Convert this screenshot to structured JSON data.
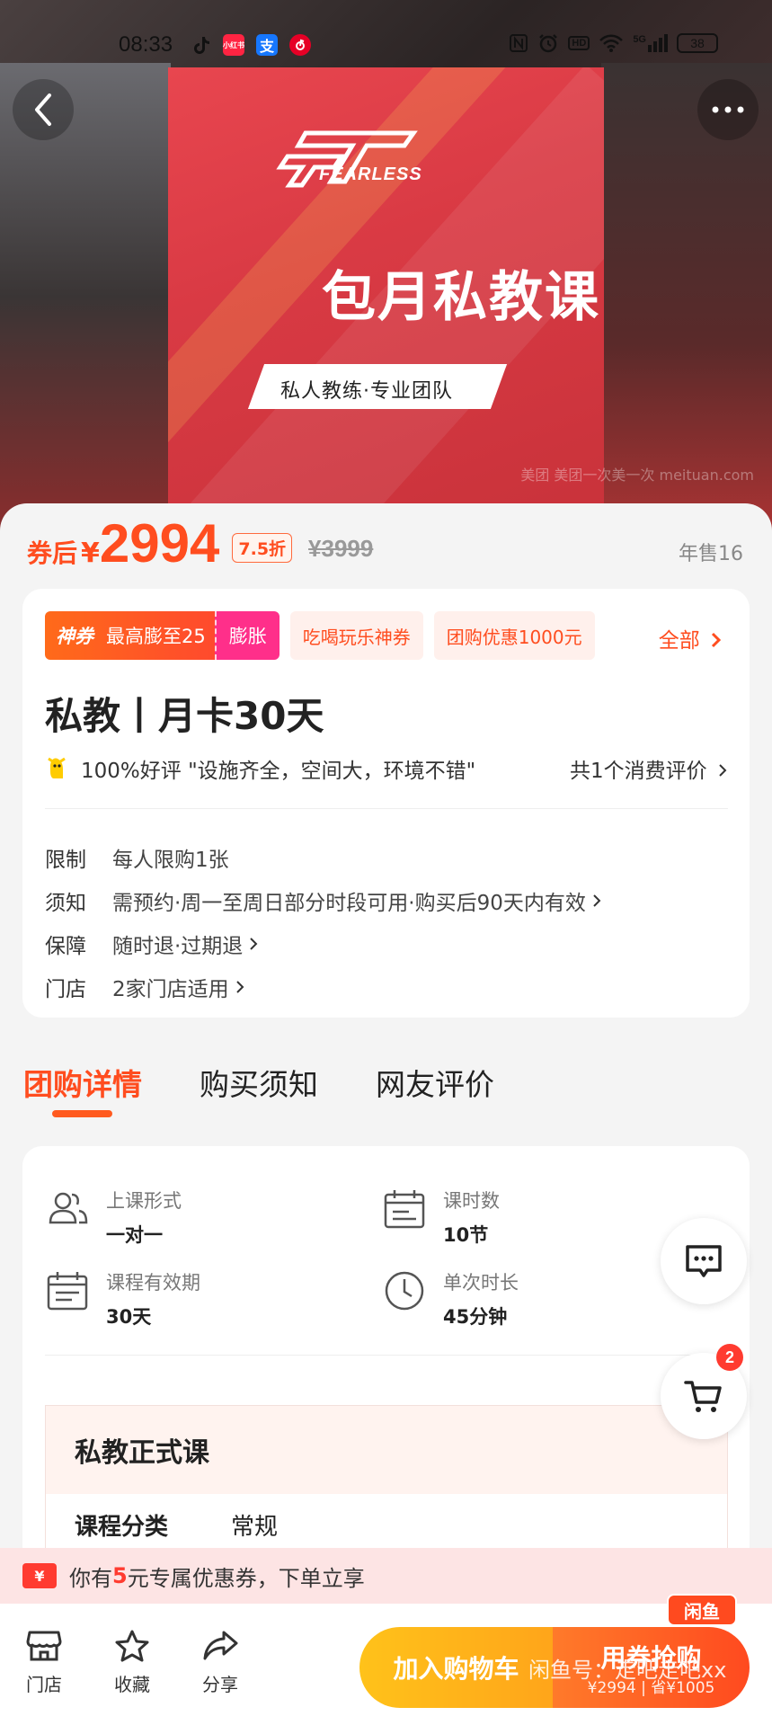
{
  "status_bar": {
    "time": "08:33",
    "apps": [
      "tiktok-icon",
      "xiaohongshu-icon",
      "alipay-icon",
      "netease-music-icon"
    ],
    "xiaohongshu_label": "小红书",
    "alipay_label": "支",
    "right_icons": [
      "nfc-icon",
      "alarm-icon",
      "hd-icon",
      "wifi-icon",
      "5g-signal-icon"
    ],
    "hd_label": "HD",
    "signal_label": "5G",
    "battery": "38"
  },
  "hero": {
    "logo_text": "FEARLESS",
    "title": "包月私教课",
    "subtitle": "私人教练·专业团队",
    "watermark": "美团 美团一次美一次 meituan.com"
  },
  "price": {
    "prefix": "券后",
    "currency": "¥",
    "value": "2994",
    "discount": "7.5折",
    "original": "¥3999",
    "sold": "年售16"
  },
  "coupons": {
    "main_tag": "神券",
    "main_text": "最高膨至25",
    "main_action": "膨胀",
    "chip1": "吃喝玩乐神券",
    "chip2": "团购优惠1000元",
    "all": "全部"
  },
  "product": {
    "title": "私教丨月卡30天",
    "review_text": "100%好评 \"设施齐全，空间大，环境不错\"",
    "review_count": "共1个消费评价"
  },
  "details": [
    {
      "key": "限制",
      "value": "每人限购1张",
      "arrow": false
    },
    {
      "key": "须知",
      "value": "需预约·周一至周日部分时段可用·购买后90天内有效",
      "arrow": true
    },
    {
      "key": "保障",
      "value": "随时退·过期退",
      "arrow": true
    },
    {
      "key": "门店",
      "value": "2家门店适用",
      "arrow": true
    }
  ],
  "tabs": [
    "团购详情",
    "购买须知",
    "网友评价"
  ],
  "attributes": [
    {
      "icon": "people-icon",
      "label": "上课形式",
      "value": "一对一"
    },
    {
      "icon": "schedule-icon",
      "label": "课时数",
      "value": "10节"
    },
    {
      "icon": "calendar-list-icon",
      "label": "课程有效期",
      "value": "30天"
    },
    {
      "icon": "clock-icon",
      "label": "单次时长",
      "value": "45分钟"
    }
  ],
  "course": {
    "title": "私教正式课",
    "category_key": "课程分类",
    "category_value": "常规"
  },
  "cart_badge": "2",
  "tip": {
    "icon": "¥",
    "prefix": "你有",
    "amount": "5",
    "suffix": "元专属优惠券，下单立享"
  },
  "bottom": {
    "store": "门店",
    "favorite": "收藏",
    "share": "分享",
    "add_cart": "加入购物车",
    "buy": "用券抢购",
    "buy_sub": "¥2994 | 省¥1005",
    "watermark": "闲鱼号：走吧走吧xx",
    "xianyu_badge": "闲鱼"
  }
}
